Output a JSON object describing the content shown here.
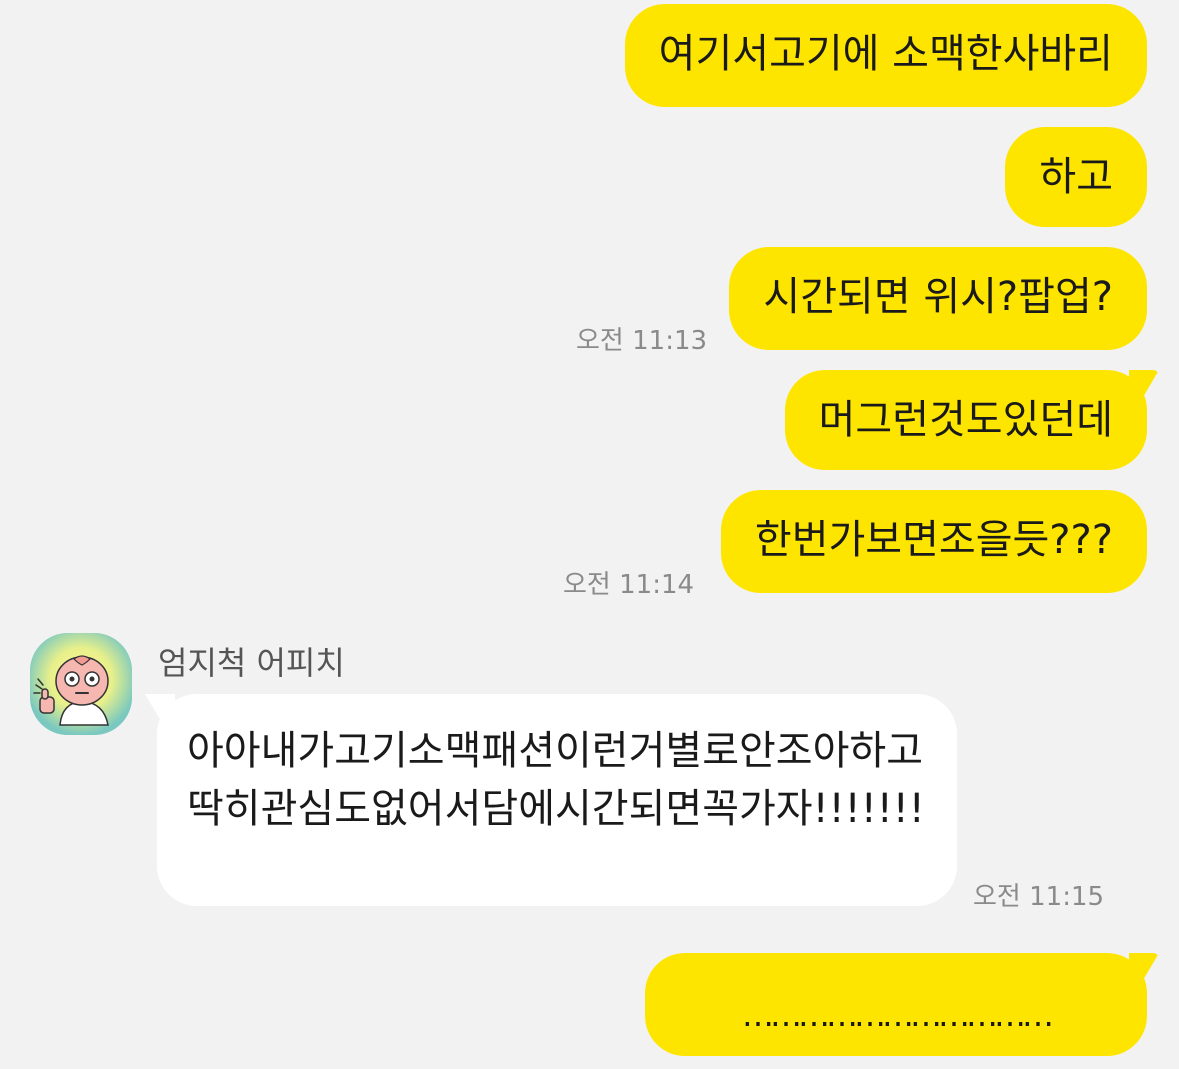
{
  "messages": [
    {
      "text": "여기서고기에 소맥한사바리"
    },
    {
      "text": "하고"
    },
    {
      "text": "시간되면 위시?팝업?",
      "time": "오전 11:13"
    },
    {
      "text": "머그런것도있던데"
    },
    {
      "text": "한번가보면조을듯???",
      "time": "오전 11:14"
    },
    {
      "sender": "엄지척 어피치",
      "text": "아아내가고기소맥패션이런거별로안조아하고딱히관심도없어서담에시간되면꼭가자!!!!!!!",
      "time": "오전 11:15"
    },
    {
      "text": "……………………………"
    }
  ],
  "colors": {
    "my_bubble": "#fee500",
    "other_bubble": "#ffffff",
    "background": "#f2f2f2",
    "timestamp": "#8a8a8a"
  },
  "icons": {
    "avatar": "apeach-thumbs-up-icon"
  }
}
